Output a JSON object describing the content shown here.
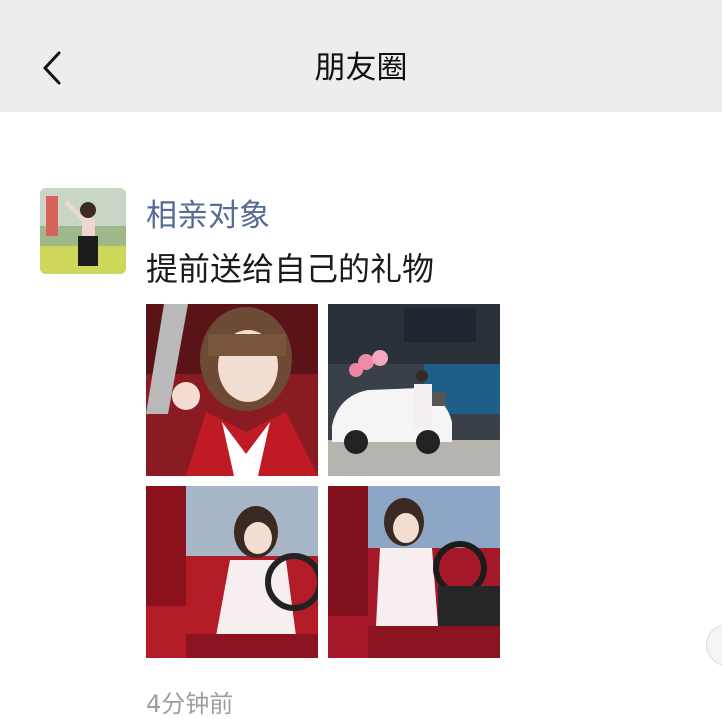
{
  "header": {
    "title": "朋友圈",
    "back_icon": "chevron-left-icon"
  },
  "post": {
    "author": "相亲对象",
    "text": "提前送给自己的礼物",
    "time": "4分钟前",
    "link_color": "#576b95",
    "photos": [
      {
        "subject": "selfie in car with red interior"
      },
      {
        "subject": "woman standing beside white SUV with balloons"
      },
      {
        "subject": "woman in driver seat with red interior"
      },
      {
        "subject": "woman in driver seat, side view"
      }
    ]
  }
}
